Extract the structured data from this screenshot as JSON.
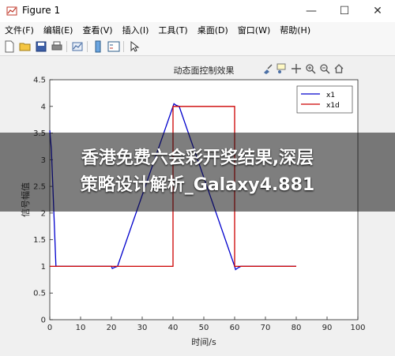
{
  "window": {
    "title": "Figure 1",
    "controls": {
      "minimize": "—",
      "maximize": "☐",
      "close": "✕"
    }
  },
  "menu": [
    "文件(F)",
    "编辑(E)",
    "查看(V)",
    "插入(I)",
    "工具(T)",
    "桌面(D)",
    "窗口(W)",
    "帮助(H)"
  ],
  "toolbar": {
    "icons": [
      "new-figure-icon",
      "open-icon",
      "save-icon",
      "print-icon",
      "link-plot-icon",
      "insert-colorbar-icon",
      "insert-legend-icon",
      "edit-plot-icon"
    ]
  },
  "axes_toolbar": {
    "icons": [
      "brush-icon",
      "datatip-icon",
      "pan-icon",
      "zoom-in-icon",
      "zoom-out-icon",
      "home-icon"
    ]
  },
  "overlay": {
    "line1": "香港免费六会彩开奖结果,深层",
    "line2": "策略设计解析_Galaxy4.881"
  },
  "colors": {
    "x1": "#0000cc",
    "x1d": "#cc0000"
  },
  "chart_data": {
    "type": "line",
    "title": "动态面控制效果",
    "xlabel": "时间/s",
    "ylabel": "信号幅值",
    "xlim": [
      0,
      100
    ],
    "ylim": [
      0,
      4.5
    ],
    "xticks": [
      0,
      10,
      20,
      30,
      40,
      50,
      60,
      70,
      80,
      90,
      100
    ],
    "yticks": [
      0,
      0.5,
      1,
      1.5,
      2,
      2.5,
      3,
      3.5,
      4,
      4.5
    ],
    "xtick_labels": [
      "0",
      "10",
      "20",
      "30",
      "40",
      "50",
      "60",
      "70",
      "80",
      "90",
      "100"
    ],
    "ytick_labels": [
      "0",
      "0.5",
      "1",
      "1.5",
      "2",
      "2.5",
      "3",
      "3.5",
      "4",
      "4.5"
    ],
    "grid": false,
    "legend_position": "top-right",
    "series": [
      {
        "name": "x1",
        "x": [
          0,
          0.5,
          1,
          2,
          20,
          20.3,
          21,
          22,
          40,
          40.3,
          41,
          42,
          60,
          60.3,
          61,
          62,
          80
        ],
        "y": [
          3.55,
          3.2,
          2.5,
          1.0,
          1.0,
          0.96,
          0.98,
          1.0,
          4.0,
          4.05,
          4.02,
          4.0,
          1.0,
          0.94,
          0.97,
          1.0,
          1.0
        ]
      },
      {
        "name": "x1d",
        "x": [
          0,
          20,
          20,
          40,
          40,
          60,
          60,
          80,
          80
        ],
        "y": [
          1,
          1,
          1,
          1,
          4,
          4,
          1,
          1,
          1
        ]
      }
    ]
  }
}
